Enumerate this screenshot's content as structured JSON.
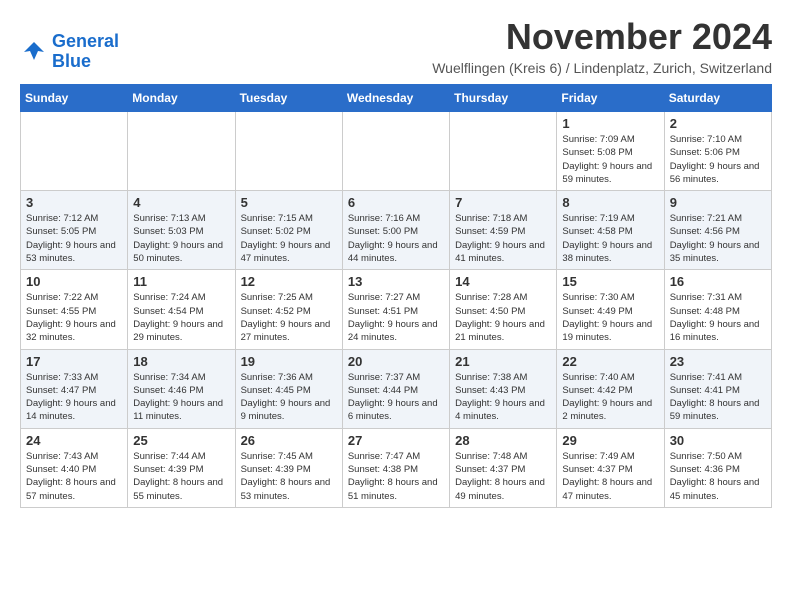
{
  "logo": {
    "line1": "General",
    "line2": "Blue"
  },
  "header": {
    "title": "November 2024",
    "location": "Wuelflingen (Kreis 6) / Lindenplatz, Zurich, Switzerland"
  },
  "weekdays": [
    "Sunday",
    "Monday",
    "Tuesday",
    "Wednesday",
    "Thursday",
    "Friday",
    "Saturday"
  ],
  "weeks": [
    [
      {
        "day": "",
        "info": ""
      },
      {
        "day": "",
        "info": ""
      },
      {
        "day": "",
        "info": ""
      },
      {
        "day": "",
        "info": ""
      },
      {
        "day": "",
        "info": ""
      },
      {
        "day": "1",
        "info": "Sunrise: 7:09 AM\nSunset: 5:08 PM\nDaylight: 9 hours and 59 minutes."
      },
      {
        "day": "2",
        "info": "Sunrise: 7:10 AM\nSunset: 5:06 PM\nDaylight: 9 hours and 56 minutes."
      }
    ],
    [
      {
        "day": "3",
        "info": "Sunrise: 7:12 AM\nSunset: 5:05 PM\nDaylight: 9 hours and 53 minutes."
      },
      {
        "day": "4",
        "info": "Sunrise: 7:13 AM\nSunset: 5:03 PM\nDaylight: 9 hours and 50 minutes."
      },
      {
        "day": "5",
        "info": "Sunrise: 7:15 AM\nSunset: 5:02 PM\nDaylight: 9 hours and 47 minutes."
      },
      {
        "day": "6",
        "info": "Sunrise: 7:16 AM\nSunset: 5:00 PM\nDaylight: 9 hours and 44 minutes."
      },
      {
        "day": "7",
        "info": "Sunrise: 7:18 AM\nSunset: 4:59 PM\nDaylight: 9 hours and 41 minutes."
      },
      {
        "day": "8",
        "info": "Sunrise: 7:19 AM\nSunset: 4:58 PM\nDaylight: 9 hours and 38 minutes."
      },
      {
        "day": "9",
        "info": "Sunrise: 7:21 AM\nSunset: 4:56 PM\nDaylight: 9 hours and 35 minutes."
      }
    ],
    [
      {
        "day": "10",
        "info": "Sunrise: 7:22 AM\nSunset: 4:55 PM\nDaylight: 9 hours and 32 minutes."
      },
      {
        "day": "11",
        "info": "Sunrise: 7:24 AM\nSunset: 4:54 PM\nDaylight: 9 hours and 29 minutes."
      },
      {
        "day": "12",
        "info": "Sunrise: 7:25 AM\nSunset: 4:52 PM\nDaylight: 9 hours and 27 minutes."
      },
      {
        "day": "13",
        "info": "Sunrise: 7:27 AM\nSunset: 4:51 PM\nDaylight: 9 hours and 24 minutes."
      },
      {
        "day": "14",
        "info": "Sunrise: 7:28 AM\nSunset: 4:50 PM\nDaylight: 9 hours and 21 minutes."
      },
      {
        "day": "15",
        "info": "Sunrise: 7:30 AM\nSunset: 4:49 PM\nDaylight: 9 hours and 19 minutes."
      },
      {
        "day": "16",
        "info": "Sunrise: 7:31 AM\nSunset: 4:48 PM\nDaylight: 9 hours and 16 minutes."
      }
    ],
    [
      {
        "day": "17",
        "info": "Sunrise: 7:33 AM\nSunset: 4:47 PM\nDaylight: 9 hours and 14 minutes."
      },
      {
        "day": "18",
        "info": "Sunrise: 7:34 AM\nSunset: 4:46 PM\nDaylight: 9 hours and 11 minutes."
      },
      {
        "day": "19",
        "info": "Sunrise: 7:36 AM\nSunset: 4:45 PM\nDaylight: 9 hours and 9 minutes."
      },
      {
        "day": "20",
        "info": "Sunrise: 7:37 AM\nSunset: 4:44 PM\nDaylight: 9 hours and 6 minutes."
      },
      {
        "day": "21",
        "info": "Sunrise: 7:38 AM\nSunset: 4:43 PM\nDaylight: 9 hours and 4 minutes."
      },
      {
        "day": "22",
        "info": "Sunrise: 7:40 AM\nSunset: 4:42 PM\nDaylight: 9 hours and 2 minutes."
      },
      {
        "day": "23",
        "info": "Sunrise: 7:41 AM\nSunset: 4:41 PM\nDaylight: 8 hours and 59 minutes."
      }
    ],
    [
      {
        "day": "24",
        "info": "Sunrise: 7:43 AM\nSunset: 4:40 PM\nDaylight: 8 hours and 57 minutes."
      },
      {
        "day": "25",
        "info": "Sunrise: 7:44 AM\nSunset: 4:39 PM\nDaylight: 8 hours and 55 minutes."
      },
      {
        "day": "26",
        "info": "Sunrise: 7:45 AM\nSunset: 4:39 PM\nDaylight: 8 hours and 53 minutes."
      },
      {
        "day": "27",
        "info": "Sunrise: 7:47 AM\nSunset: 4:38 PM\nDaylight: 8 hours and 51 minutes."
      },
      {
        "day": "28",
        "info": "Sunrise: 7:48 AM\nSunset: 4:37 PM\nDaylight: 8 hours and 49 minutes."
      },
      {
        "day": "29",
        "info": "Sunrise: 7:49 AM\nSunset: 4:37 PM\nDaylight: 8 hours and 47 minutes."
      },
      {
        "day": "30",
        "info": "Sunrise: 7:50 AM\nSunset: 4:36 PM\nDaylight: 8 hours and 45 minutes."
      }
    ]
  ]
}
